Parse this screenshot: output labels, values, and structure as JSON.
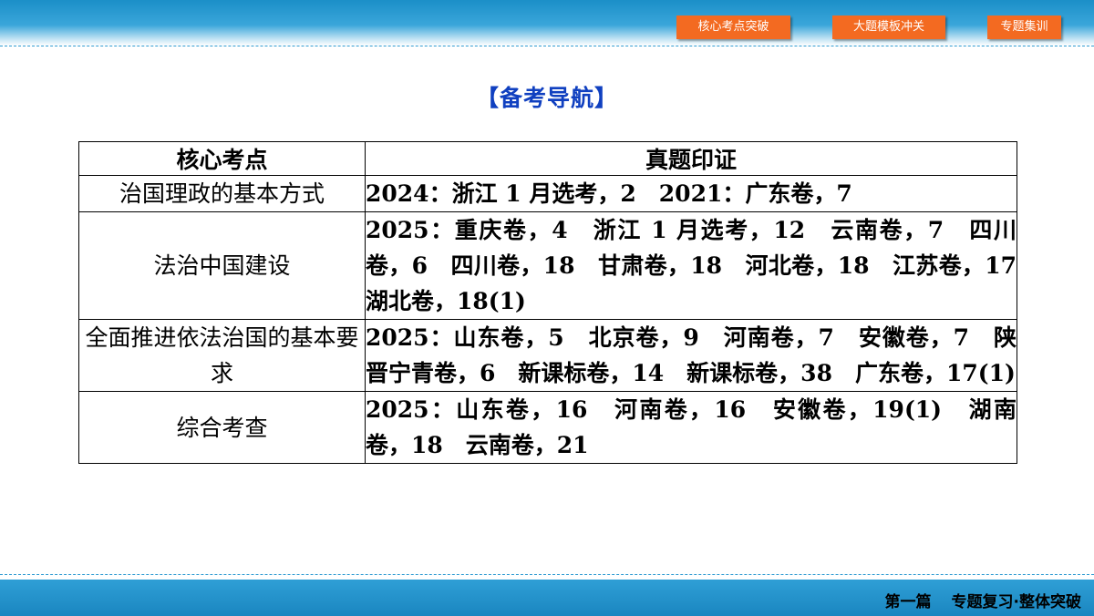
{
  "nav": {
    "buttons": [
      "核心考点突破",
      "大题模板冲关",
      "专题集训"
    ]
  },
  "title": "【备考导航】",
  "table": {
    "headers": [
      "核心考点",
      "真题印证"
    ],
    "rows": [
      {
        "topic": "治国理政的基本方式",
        "evidence": "2024：浙江 1 月选考，2　2021：广东卷，7"
      },
      {
        "topic": "法治中国建设",
        "evidence": "2025：重庆卷，4　浙江 1 月选考，12　云南卷，7　四川卷，6　四川卷，18　甘肃卷，18　河北卷，18　江苏卷，17　湖北卷，18(1)"
      },
      {
        "topic": "全面推进依法治国的基本要求",
        "evidence": "2025：山东卷，5　北京卷，9　河南卷，7　安徽卷，7　陕晋宁青卷，6　新课标卷，14　新课标卷，38　广东卷，17(1)"
      },
      {
        "topic": "综合考查",
        "evidence": "2025：山东卷，16　河南卷，16　安徽卷，19(1)　湖南卷，18　云南卷，21"
      }
    ]
  },
  "footer": {
    "part": "第一篇",
    "section": "专题复习·整体突破"
  },
  "colors": {
    "band": "#1b8fc8",
    "button": "#f36a21",
    "title": "#1040c0"
  }
}
